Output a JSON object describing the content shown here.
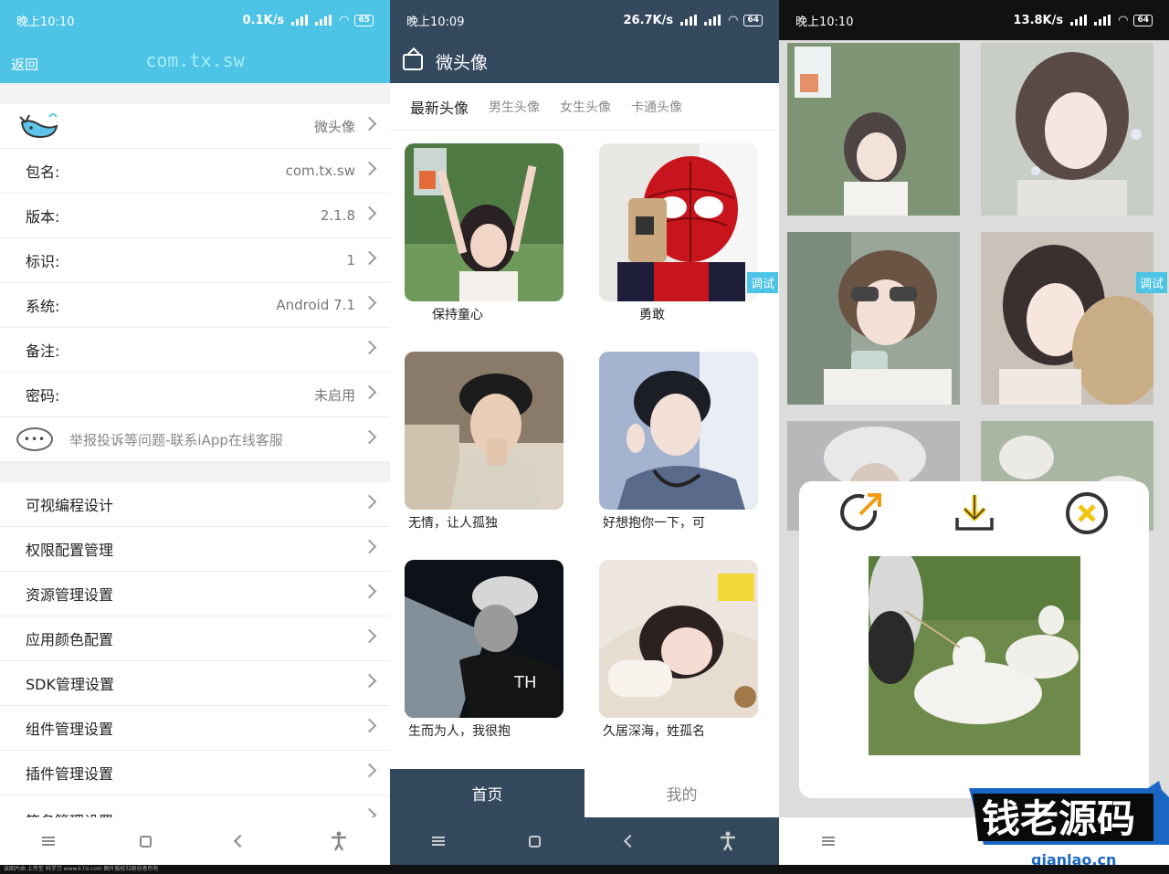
{
  "panel1": {
    "status": {
      "time": "晚上10:10",
      "net": "0.1K/s",
      "battery": "65"
    },
    "appbar": {
      "back": "返回",
      "title": "com.tx.sw"
    },
    "info_rows": [
      {
        "label": "",
        "value": "微头像"
      },
      {
        "label": "包名:",
        "value": "com.tx.sw"
      },
      {
        "label": "版本:",
        "value": "2.1.8"
      },
      {
        "label": "标识:",
        "value": "1"
      },
      {
        "label": "系统:",
        "value": "Android 7.1"
      },
      {
        "label": "备注:",
        "value": ""
      },
      {
        "label": "密码:",
        "value": "未启用"
      }
    ],
    "report_row": "举报投诉等问题-联系iApp在线客服",
    "settings_rows": [
      "可视编程设计",
      "权限配置管理",
      "资源管理设置",
      "应用颜色配置",
      "SDK管理设置",
      "组件管理设置",
      "插件管理设置",
      "签名管理设置"
    ],
    "accent": "#4dc3e6"
  },
  "panel2": {
    "status": {
      "time": "晚上10:09",
      "net": "26.7K/s",
      "battery": "64"
    },
    "appbar": {
      "title": "微头像"
    },
    "tabs": [
      "最新头像",
      "男生头像",
      "女生头像",
      "卡通头像"
    ],
    "cards": [
      {
        "caption": "保持童心"
      },
      {
        "caption": "勇敢"
      },
      {
        "caption": "无情，让人孤独"
      },
      {
        "caption": "好想抱你一下，可"
      },
      {
        "caption": "生而为人，我很抱"
      },
      {
        "caption": "久居深海，姓孤名"
      }
    ],
    "debug_label": "调试",
    "bottom_nav": [
      "首页",
      "我的"
    ],
    "accent": "#34495e"
  },
  "panel3": {
    "status": {
      "time": "晚上10:10",
      "net": "13.8K/s",
      "battery": "64"
    },
    "debug_label": "调试",
    "dialog_icons": [
      "share-icon",
      "download-icon",
      "close-icon"
    ]
  },
  "watermark": {
    "main": "钱老源码",
    "sub": "qianlao.cn"
  },
  "footer": "该图片由 上传至 科学刀 www.k7d.com 图片版权归原创者所有"
}
